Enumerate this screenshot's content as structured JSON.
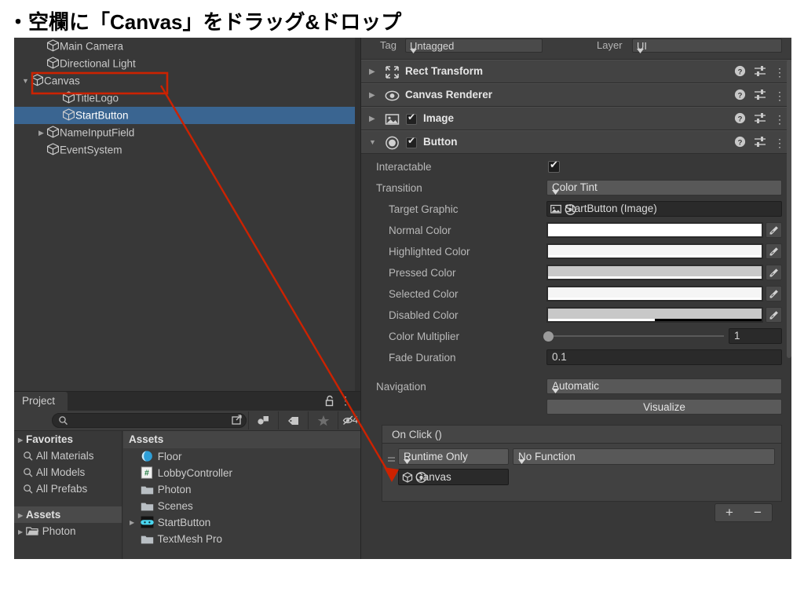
{
  "slide": {
    "title": "・空欄に「Canvas」をドラッグ&ドロップ"
  },
  "colors": {
    "accent_red": "#cc2200",
    "selection_blue": "#3a6591",
    "panel_bg": "#383838",
    "header_bg": "#434343",
    "field_bg": "#2a2a2a",
    "dropdown_bg": "#585858"
  },
  "hierarchy": {
    "items": [
      {
        "label": "Main Camera",
        "indent": 1,
        "arrow": "none",
        "selected": false,
        "icon": "gameobject-cube-icon"
      },
      {
        "label": "Directional Light",
        "indent": 1,
        "arrow": "none",
        "selected": false,
        "icon": "gameobject-cube-icon"
      },
      {
        "label": "Canvas",
        "indent": 0,
        "arrow": "expanded",
        "selected": false,
        "icon": "gameobject-cube-icon"
      },
      {
        "label": "TitleLogo",
        "indent": 2,
        "arrow": "none",
        "selected": false,
        "icon": "gameobject-cube-icon"
      },
      {
        "label": "StartButton",
        "indent": 2,
        "arrow": "none",
        "selected": true,
        "icon": "gameobject-cube-icon"
      },
      {
        "label": "NameInputField",
        "indent": 1,
        "arrow": "collapsed",
        "selected": false,
        "icon": "gameobject-cube-icon"
      },
      {
        "label": "EventSystem",
        "indent": 1,
        "arrow": "none",
        "selected": false,
        "icon": "gameobject-cube-icon"
      }
    ]
  },
  "project": {
    "tab_label": "Project",
    "lock_icon": "lock-open-icon",
    "kebab_icon": "kebab-menu-icon",
    "search": {
      "value": "",
      "placeholder": ""
    },
    "toolbar_icons": [
      "expand-icon",
      "object-filter-icon",
      "label-filter-icon",
      "favorite-star-icon",
      "hidden-eye-icon"
    ],
    "hidden_count": "4",
    "favorites": {
      "header": "Favorites",
      "items": [
        "All Materials",
        "All Models",
        "All Prefabs"
      ]
    },
    "tree": {
      "header": "Assets",
      "items": [
        {
          "label": "Photon",
          "arrow": "collapsed",
          "icon": "folder-open-icon"
        }
      ]
    },
    "assets_header": "Assets",
    "assets": [
      {
        "label": "Floor",
        "icon": "material-sphere-icon",
        "arrow": "none"
      },
      {
        "label": "LobbyController",
        "icon": "csharp-script-icon",
        "arrow": "none"
      },
      {
        "label": "Photon",
        "icon": "folder-icon",
        "arrow": "none"
      },
      {
        "label": "Scenes",
        "icon": "folder-icon",
        "arrow": "none"
      },
      {
        "label": "StartButton",
        "icon": "prefab-icon",
        "arrow": "collapsed"
      },
      {
        "label": "TextMesh Pro",
        "icon": "folder-icon",
        "arrow": "none"
      }
    ]
  },
  "inspector": {
    "tag_label": "Tag",
    "tag_value": "Untagged",
    "layer_label": "Layer",
    "layer_value": "UI",
    "components": [
      {
        "name": "Rect Transform",
        "icon": "rect-transform-icon",
        "expanded": false,
        "has_checkbox": false,
        "enabled": false
      },
      {
        "name": "Canvas Renderer",
        "icon": "canvas-renderer-eye-icon",
        "expanded": false,
        "has_checkbox": false,
        "enabled": false
      },
      {
        "name": "Image",
        "icon": "image-component-icon",
        "expanded": false,
        "has_checkbox": true,
        "enabled": true
      },
      {
        "name": "Button",
        "icon": "button-component-icon",
        "expanded": true,
        "has_checkbox": true,
        "enabled": true
      }
    ],
    "header_icons": [
      "help-icon",
      "preset-icon",
      "kebab-menu-icon"
    ],
    "button": {
      "interactable_label": "Interactable",
      "interactable_value": true,
      "transition_label": "Transition",
      "transition_value": "Color Tint",
      "target_graphic_label": "Target Graphic",
      "target_graphic_value": "StartButton (Image)",
      "target_graphic_icon": "image-component-icon",
      "colors": [
        {
          "label": "Normal Color",
          "hex": "#ffffff",
          "alpha": 100
        },
        {
          "label": "Highlighted Color",
          "hex": "#f5f5f5",
          "alpha": 100
        },
        {
          "label": "Pressed Color",
          "hex": "#c8c8c8",
          "alpha": 100
        },
        {
          "label": "Selected Color",
          "hex": "#f5f5f5",
          "alpha": 100
        },
        {
          "label": "Disabled Color",
          "hex": "#c8c8c8",
          "alpha": 50
        }
      ],
      "color_multiplier_label": "Color Multiplier",
      "color_multiplier_value": "1",
      "fade_duration_label": "Fade Duration",
      "fade_duration_value": "0.1",
      "navigation_label": "Navigation",
      "navigation_value": "Automatic",
      "visualize_label": "Visualize",
      "onclick_header": "On Click ()",
      "event": {
        "mode": "Runtime Only",
        "function": "No Function",
        "object": "Canvas",
        "object_icon": "gameobject-cube-icon"
      },
      "add_label": "+",
      "remove_label": "−"
    }
  }
}
